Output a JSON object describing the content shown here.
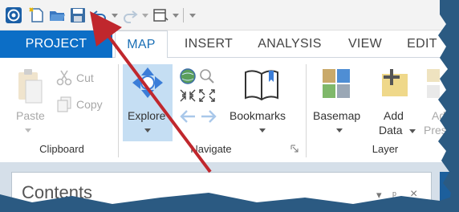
{
  "tabs": [
    {
      "label": "PROJECT"
    },
    {
      "label": "MAP"
    },
    {
      "label": "INSERT"
    },
    {
      "label": "ANALYSIS"
    },
    {
      "label": "VIEW"
    },
    {
      "label": "EDIT"
    }
  ],
  "clipboard": {
    "paste": "Paste",
    "cut": "Cut",
    "copy": "Copy",
    "group": "Clipboard"
  },
  "navigate": {
    "explore": "Explore",
    "bookmarks": "Bookmarks",
    "group": "Navigate"
  },
  "layer": {
    "basemap": "Basemap",
    "add": "Add",
    "data": "Data",
    "add2": "Add",
    "preset": "Prese",
    "group": "Layer"
  },
  "pane": {
    "title": "Contents",
    "pin": "− Ѩ ×"
  },
  "colors": {
    "project_tab": "#0c6ec6",
    "annotation_arrow": "#c0272d",
    "explore_highlight": "#c5def3"
  }
}
